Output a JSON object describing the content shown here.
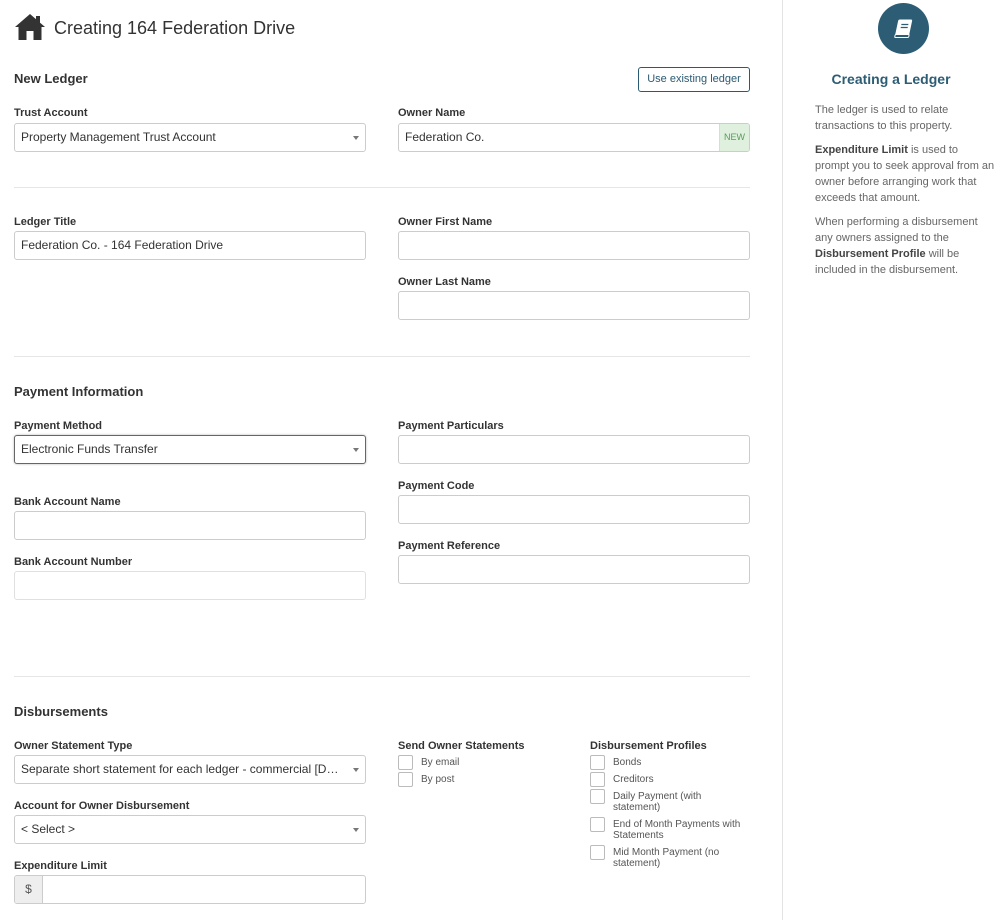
{
  "header": {
    "title": "Creating 164 Federation Drive",
    "icon": "home-icon"
  },
  "new_ledger": {
    "section_title": "New Ledger",
    "use_existing_label": "Use existing ledger",
    "trust_account": {
      "label": "Trust Account",
      "value": "Property Management Trust Account"
    },
    "owner_name": {
      "label": "Owner Name",
      "value": "Federation Co.",
      "badge": "NEW"
    },
    "ledger_title": {
      "label": "Ledger Title",
      "value": "Federation Co. - 164 Federation Drive"
    },
    "owner_first_name": {
      "label": "Owner First Name",
      "value": ""
    },
    "owner_last_name": {
      "label": "Owner Last Name",
      "value": ""
    }
  },
  "payment": {
    "section_title": "Payment Information",
    "method": {
      "label": "Payment Method",
      "value": "Electronic Funds Transfer"
    },
    "particulars": {
      "label": "Payment Particulars",
      "value": ""
    },
    "bank_account_name": {
      "label": "Bank Account Name",
      "value": ""
    },
    "code": {
      "label": "Payment Code",
      "value": ""
    },
    "bank_account_number": {
      "label": "Bank Account Number",
      "value": ""
    },
    "reference": {
      "label": "Payment Reference",
      "value": ""
    }
  },
  "disbursements": {
    "section_title": "Disbursements",
    "statement_type": {
      "label": "Owner Statement Type",
      "value": "Separate short statement for each ledger - commercial [DEFAULT]"
    },
    "account": {
      "label": "Account for Owner Disbursement",
      "value": "< Select >"
    },
    "expenditure": {
      "label": "Expenditure Limit",
      "addon": "$",
      "value": ""
    },
    "send_statements": {
      "label": "Send Owner Statements",
      "options": [
        "By email",
        "By post"
      ]
    },
    "profiles": {
      "label": "Disbursement Profiles",
      "options": [
        "Bonds",
        "Creditors",
        "Daily Payment (with statement)",
        "End of Month Payments with Statements",
        "Mid Month Payment (no statement)"
      ]
    }
  },
  "sidebar": {
    "icon": "book-icon",
    "title": "Creating a Ledger",
    "p1": "The ledger is used to relate transactions to this property.",
    "p2_bold": "Expenditure Limit",
    "p2_rest": " is used to prompt you to seek approval from an owner before arranging work that exceeds that amount.",
    "p3_start": "When performing a disbursement any owners assigned to the ",
    "p3_bold": "Disbursement Profile",
    "p3_end": " will be included in the disbursement."
  },
  "colors": {
    "accent": "#2c5d74",
    "new_badge_bg": "#dff1de"
  }
}
